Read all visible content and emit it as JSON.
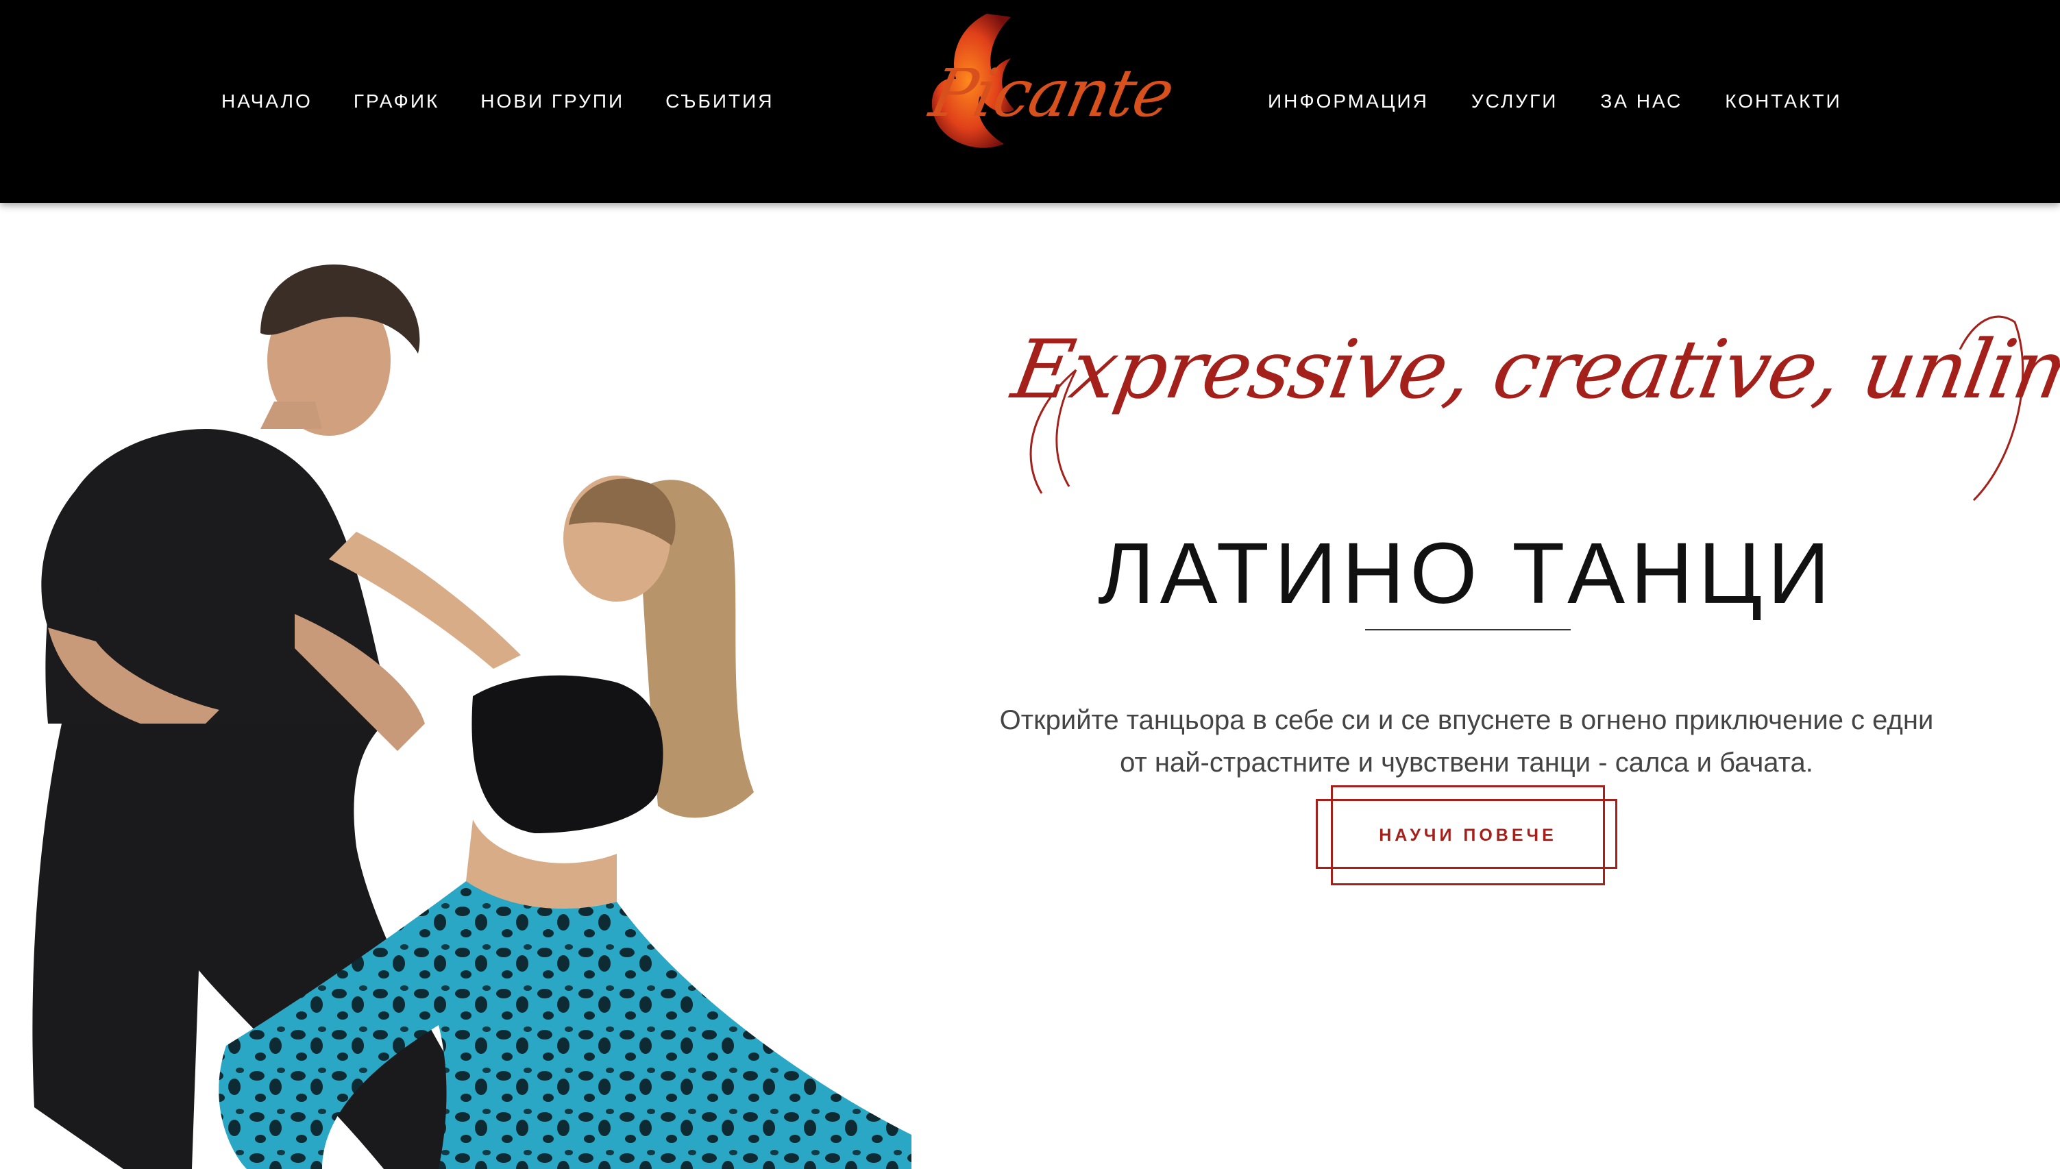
{
  "header": {
    "nav_left": [
      {
        "label": "НАЧАЛО"
      },
      {
        "label": "ГРАФИК"
      },
      {
        "label": "НОВИ ГРУПИ"
      },
      {
        "label": "СЪБИТИЯ"
      }
    ],
    "logo_text": "Picante",
    "nav_right": [
      {
        "label": "ИНФОРМАЦИЯ"
      },
      {
        "label": "УСЛУГИ"
      },
      {
        "label": "ЗА НАС"
      },
      {
        "label": "КОНТАКТИ"
      }
    ]
  },
  "hero": {
    "tagline": "Expressive, creative, unlimited",
    "title": "ЛАТИНО ТАНЦИ",
    "description": "Открийте танцьора в себе си и се впуснете в огнено приключение с едни от най-страстните и чувствени танци - салса и бачата.",
    "cta_label": "НАУЧИ ПОВЕЧЕ"
  },
  "colors": {
    "header_bg": "#000000",
    "accent_red": "#a3201b",
    "logo_orange": "#d8501c",
    "leggings_teal": "#2aa7c4"
  }
}
